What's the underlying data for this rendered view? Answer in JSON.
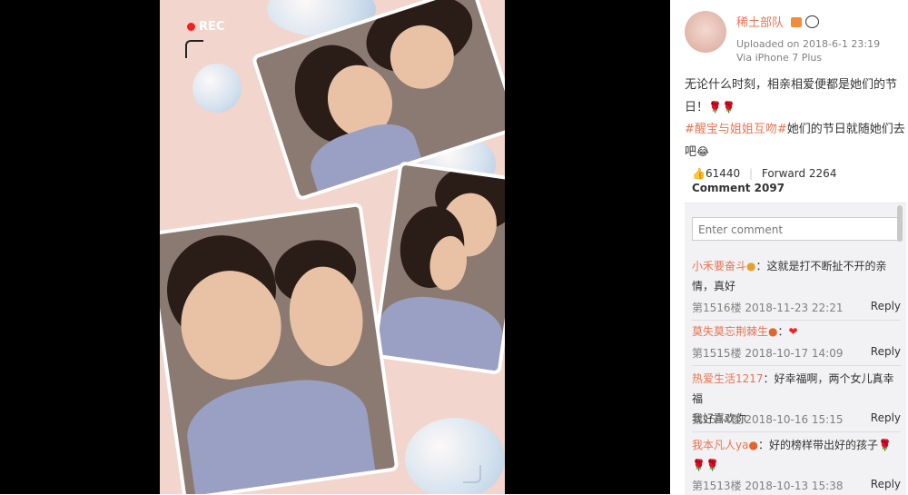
{
  "photo": {
    "rec_label": "REC"
  },
  "post": {
    "username": "稀土部队",
    "upload_text": "Uploaded on 2018-6-1 23:19",
    "device_text": "Via iPhone 7 Plus",
    "text_line1": "无论什么时刻，相亲相爱便都是她们的节",
    "text_line2": "日！",
    "hashtag": "#醒宝与姐姐互吻#",
    "text_after_tag": "她们的节日就随她们去",
    "text_line4": "吧"
  },
  "stats": {
    "likes": "61440",
    "forward": "Forward 2264",
    "comment": "Comment 2097"
  },
  "comment_input": {
    "placeholder": "Enter comment"
  },
  "comments": [
    {
      "user": "小禾要奋斗",
      "text": "：这就是打不断扯不开的亲",
      "text2": "情，真好",
      "meta": "第1516楼 2018-11-23 22:21",
      "reply": "Reply"
    },
    {
      "user": "莫失莫忘荆棘生",
      "text": "：",
      "text2": "",
      "meta": "第1515楼 2018-10-17 14:09",
      "reply": "Reply"
    },
    {
      "user": "热爱生活1217",
      "text": "：好幸福啊，两个女儿真幸福",
      "text2": "我好喜欢你",
      "meta": "第1514楼 2018-10-16 15:15",
      "reply": "Reply"
    },
    {
      "user": "我本凡人ya",
      "text": "：好的榜样带出好的孩子",
      "text2": "",
      "meta": "第1513楼 2018-10-13 15:38",
      "reply": "Reply"
    }
  ],
  "colors": {
    "accent": "#eb7350",
    "viewer_bg": "#000000",
    "photo_bg": "#f2d5cc"
  }
}
